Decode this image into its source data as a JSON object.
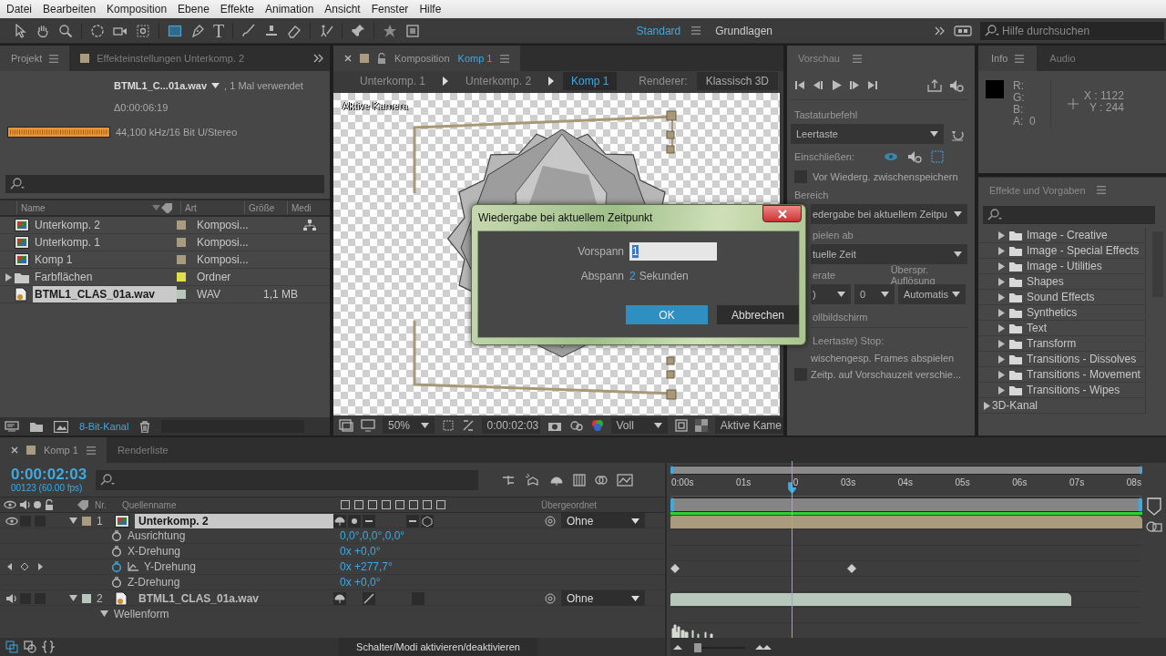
{
  "menu": [
    "Datei",
    "Bearbeiten",
    "Komposition",
    "Ebene",
    "Effekte",
    "Animation",
    "Ansicht",
    "Fenster",
    "Hilfe"
  ],
  "toolbar": {
    "text_tool": "T",
    "workspaces": [
      {
        "label": "Standard",
        "selected": true
      },
      {
        "label": "Grundlagen",
        "selected": false
      }
    ],
    "help_search": {
      "placeholder": "Hilfe durchsuchen"
    }
  },
  "project": {
    "tabs": [
      {
        "label": "Projekt",
        "selected": true
      },
      {
        "label": "Effekteinstellungen Unterkomp. 2",
        "selected": false
      }
    ],
    "footage": {
      "name": "BTML1_C...01a.wav",
      "usage": ", 1 Mal verwendet",
      "duration": "Δ0:00:06:19",
      "format": "44,100 kHz/16 Bit U/Stereo"
    },
    "columns": [
      "Name",
      "Art",
      "Größe",
      "Medi"
    ],
    "items": [
      {
        "name": "Unterkomp. 2",
        "kind": "comp",
        "color": "#a99b7e",
        "type": "Komposi...",
        "selected": false
      },
      {
        "name": "Unterkomp. 1",
        "kind": "comp",
        "color": "#a99b7e",
        "type": "Komposi...",
        "selected": false
      },
      {
        "name": "Komp 1",
        "kind": "comp",
        "color": "#a99b7e",
        "type": "Komposi...",
        "selected": false
      },
      {
        "name": "Farbflächen",
        "kind": "folder",
        "color": "#e0e04a",
        "type": "Ordner",
        "selected": false
      },
      {
        "name": "BTML1_CLAS_01a.wav",
        "kind": "audio",
        "color": "#b8c7bc",
        "type": "WAV",
        "size": "1,1 MB",
        "selected": true
      }
    ],
    "bit_depth": "8-Bit-Kanal"
  },
  "composition": {
    "title": "Komposition",
    "name": "Komp 1",
    "breadcrumbs": [
      {
        "label": "Unterkomp. 1",
        "selected": false
      },
      {
        "label": "Unterkomp. 2",
        "selected": false
      },
      {
        "label": "Komp 1",
        "selected": true
      }
    ],
    "renderer_label": "Renderer:",
    "renderer": "Klassisch 3D",
    "camera": "Aktive Kamera",
    "zoom": "50%",
    "time": "0:00:02:03",
    "resolution": "Voll",
    "view": "Aktive Kame"
  },
  "dialog": {
    "title": "Wiedergabe bei aktuellem Zeitpunkt",
    "lead_label": "Vorspann",
    "lead_value": "1",
    "tail_label": "Abspann",
    "tail_value": "2",
    "tail_unit": "Sekunden",
    "buttons": [
      {
        "label": "OK",
        "kind": "primary"
      },
      {
        "label": "Abbrechen",
        "kind": "secondary"
      }
    ]
  },
  "preview": {
    "title": "Vorschau",
    "shortcut_label": "Tastaturbefehl",
    "shortcut": "Leertaste",
    "include_label": "Einschließen:",
    "cache": {
      "label": "Vor Wiederg. zwischenspeichern",
      "checked": false
    },
    "range_label": "Bereich",
    "range": "edergabe bei aktuellem Zeitpu",
    "play_from_label": "pielen ab",
    "play_from": "tuelle Zeit",
    "framerate_label": "erate",
    "skip_label": "Überspr. Auflösung",
    "framerate": ")",
    "skip": "0",
    "resolution": "Automatis",
    "fullscreen_label": "ollbildschirm",
    "stop_label": "Leertaste) Stop:",
    "stop_options": [
      {
        "label": "wischengesp. Frames abspielen"
      },
      {
        "label": "Zeitp. auf Vorschauzeit verschie...",
        "checked": false
      }
    ]
  },
  "info": {
    "tabs": [
      {
        "label": "Info",
        "selected": true
      },
      {
        "label": "Audio",
        "selected": false
      }
    ],
    "channels": [
      {
        "label": "R:"
      },
      {
        "label": "G:"
      },
      {
        "label": "B:"
      },
      {
        "label": "A:",
        "value": "0"
      }
    ],
    "x": "X : 1122",
    "y": "Y : 244"
  },
  "effects": {
    "title": "Effekte und Vorgaben",
    "folders": [
      "Image - Creative",
      "Image - Special Effects",
      "Image - Utilities",
      "Shapes",
      "Sound Effects",
      "Synthetics",
      "Text",
      "Transform",
      "Transitions - Dissolves",
      "Transitions - Movement",
      "Transitions - Wipes"
    ],
    "categories": [
      "3D-Kanal"
    ]
  },
  "timeline": {
    "tabs": [
      {
        "label": "Komp 1",
        "selected": true
      },
      {
        "label": "Renderliste",
        "selected": false
      }
    ],
    "time": "0:00:02:03",
    "frame": "00123 (60.00 fps)",
    "columns": {
      "number": "Nr.",
      "source": "Quellenname",
      "parent": "Übergeordnet"
    },
    "layers": [
      {
        "number": "1",
        "name": "Unterkomp. 2",
        "kind": "comp",
        "color": "#a99b7e",
        "selected": true,
        "parent": "Ohne",
        "level": 1,
        "properties": [
          {
            "name": "Ausrichtung",
            "value": "0,0°,0,0°,0,0°",
            "animated": false
          },
          {
            "name": "X-Drehung",
            "value": "0x +0,0°",
            "animated": false
          },
          {
            "name": "Y-Drehung",
            "value": "0x +277,7°",
            "animated": true
          },
          {
            "name": "Z-Drehung",
            "value": "0x +0,0°",
            "animated": false
          }
        ]
      },
      {
        "number": "2",
        "name": "BTML1_CLAS_01a.wav",
        "kind": "audio",
        "color": "#b8c7bc",
        "selected": false,
        "parent": "Ohne",
        "level": 0.85,
        "groups": [
          "Wellenform"
        ]
      }
    ],
    "ruler": [
      "0:00s",
      "01s",
      "0",
      "03s",
      "04s",
      "05s",
      "06s",
      "07s",
      "08s"
    ],
    "playhead": {
      "level": 0.256
    },
    "footer": "Schalter/Modi aktivieren/deaktivieren"
  }
}
